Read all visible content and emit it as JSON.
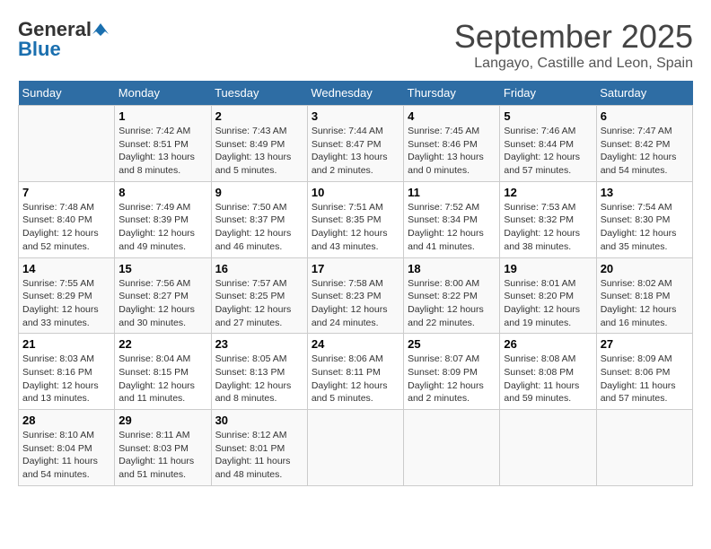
{
  "logo": {
    "general": "General",
    "blue": "Blue"
  },
  "title": "September 2025",
  "subtitle": "Langayo, Castille and Leon, Spain",
  "days_of_week": [
    "Sunday",
    "Monday",
    "Tuesday",
    "Wednesday",
    "Thursday",
    "Friday",
    "Saturday"
  ],
  "weeks": [
    [
      {
        "num": "",
        "info": ""
      },
      {
        "num": "1",
        "info": "Sunrise: 7:42 AM\nSunset: 8:51 PM\nDaylight: 13 hours\nand 8 minutes."
      },
      {
        "num": "2",
        "info": "Sunrise: 7:43 AM\nSunset: 8:49 PM\nDaylight: 13 hours\nand 5 minutes."
      },
      {
        "num": "3",
        "info": "Sunrise: 7:44 AM\nSunset: 8:47 PM\nDaylight: 13 hours\nand 2 minutes."
      },
      {
        "num": "4",
        "info": "Sunrise: 7:45 AM\nSunset: 8:46 PM\nDaylight: 13 hours\nand 0 minutes."
      },
      {
        "num": "5",
        "info": "Sunrise: 7:46 AM\nSunset: 8:44 PM\nDaylight: 12 hours\nand 57 minutes."
      },
      {
        "num": "6",
        "info": "Sunrise: 7:47 AM\nSunset: 8:42 PM\nDaylight: 12 hours\nand 54 minutes."
      }
    ],
    [
      {
        "num": "7",
        "info": "Sunrise: 7:48 AM\nSunset: 8:40 PM\nDaylight: 12 hours\nand 52 minutes."
      },
      {
        "num": "8",
        "info": "Sunrise: 7:49 AM\nSunset: 8:39 PM\nDaylight: 12 hours\nand 49 minutes."
      },
      {
        "num": "9",
        "info": "Sunrise: 7:50 AM\nSunset: 8:37 PM\nDaylight: 12 hours\nand 46 minutes."
      },
      {
        "num": "10",
        "info": "Sunrise: 7:51 AM\nSunset: 8:35 PM\nDaylight: 12 hours\nand 43 minutes."
      },
      {
        "num": "11",
        "info": "Sunrise: 7:52 AM\nSunset: 8:34 PM\nDaylight: 12 hours\nand 41 minutes."
      },
      {
        "num": "12",
        "info": "Sunrise: 7:53 AM\nSunset: 8:32 PM\nDaylight: 12 hours\nand 38 minutes."
      },
      {
        "num": "13",
        "info": "Sunrise: 7:54 AM\nSunset: 8:30 PM\nDaylight: 12 hours\nand 35 minutes."
      }
    ],
    [
      {
        "num": "14",
        "info": "Sunrise: 7:55 AM\nSunset: 8:29 PM\nDaylight: 12 hours\nand 33 minutes."
      },
      {
        "num": "15",
        "info": "Sunrise: 7:56 AM\nSunset: 8:27 PM\nDaylight: 12 hours\nand 30 minutes."
      },
      {
        "num": "16",
        "info": "Sunrise: 7:57 AM\nSunset: 8:25 PM\nDaylight: 12 hours\nand 27 minutes."
      },
      {
        "num": "17",
        "info": "Sunrise: 7:58 AM\nSunset: 8:23 PM\nDaylight: 12 hours\nand 24 minutes."
      },
      {
        "num": "18",
        "info": "Sunrise: 8:00 AM\nSunset: 8:22 PM\nDaylight: 12 hours\nand 22 minutes."
      },
      {
        "num": "19",
        "info": "Sunrise: 8:01 AM\nSunset: 8:20 PM\nDaylight: 12 hours\nand 19 minutes."
      },
      {
        "num": "20",
        "info": "Sunrise: 8:02 AM\nSunset: 8:18 PM\nDaylight: 12 hours\nand 16 minutes."
      }
    ],
    [
      {
        "num": "21",
        "info": "Sunrise: 8:03 AM\nSunset: 8:16 PM\nDaylight: 12 hours\nand 13 minutes."
      },
      {
        "num": "22",
        "info": "Sunrise: 8:04 AM\nSunset: 8:15 PM\nDaylight: 12 hours\nand 11 minutes."
      },
      {
        "num": "23",
        "info": "Sunrise: 8:05 AM\nSunset: 8:13 PM\nDaylight: 12 hours\nand 8 minutes."
      },
      {
        "num": "24",
        "info": "Sunrise: 8:06 AM\nSunset: 8:11 PM\nDaylight: 12 hours\nand 5 minutes."
      },
      {
        "num": "25",
        "info": "Sunrise: 8:07 AM\nSunset: 8:09 PM\nDaylight: 12 hours\nand 2 minutes."
      },
      {
        "num": "26",
        "info": "Sunrise: 8:08 AM\nSunset: 8:08 PM\nDaylight: 11 hours\nand 59 minutes."
      },
      {
        "num": "27",
        "info": "Sunrise: 8:09 AM\nSunset: 8:06 PM\nDaylight: 11 hours\nand 57 minutes."
      }
    ],
    [
      {
        "num": "28",
        "info": "Sunrise: 8:10 AM\nSunset: 8:04 PM\nDaylight: 11 hours\nand 54 minutes."
      },
      {
        "num": "29",
        "info": "Sunrise: 8:11 AM\nSunset: 8:03 PM\nDaylight: 11 hours\nand 51 minutes."
      },
      {
        "num": "30",
        "info": "Sunrise: 8:12 AM\nSunset: 8:01 PM\nDaylight: 11 hours\nand 48 minutes."
      },
      {
        "num": "",
        "info": ""
      },
      {
        "num": "",
        "info": ""
      },
      {
        "num": "",
        "info": ""
      },
      {
        "num": "",
        "info": ""
      }
    ]
  ]
}
